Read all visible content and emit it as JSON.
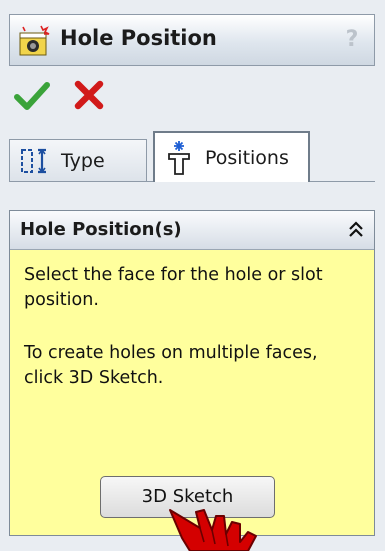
{
  "header": {
    "title": "Hole Position",
    "help": "?"
  },
  "actions": {
    "ok_icon": "checkmark-icon",
    "cancel_icon": "x-icon",
    "ok_color": "#3aa33a",
    "cancel_color": "#d11a1a"
  },
  "tabs": [
    {
      "label": "Type",
      "icon": "hole-type-icon",
      "selected": false
    },
    {
      "label": "Positions",
      "icon": "hole-position-icon",
      "selected": true
    }
  ],
  "group": {
    "title": "Hole Position(s)",
    "collapse_icon": "double-chevron-up-icon",
    "background": "#ffff9d",
    "message_1": "Select the face for the hole or slot position.",
    "message_2": "To create holes on multiple faces, click 3D Sketch.",
    "button_label": "3D Sketch"
  },
  "cursor": {
    "icon": "hand-cursor-icon",
    "color": "#d40000"
  }
}
